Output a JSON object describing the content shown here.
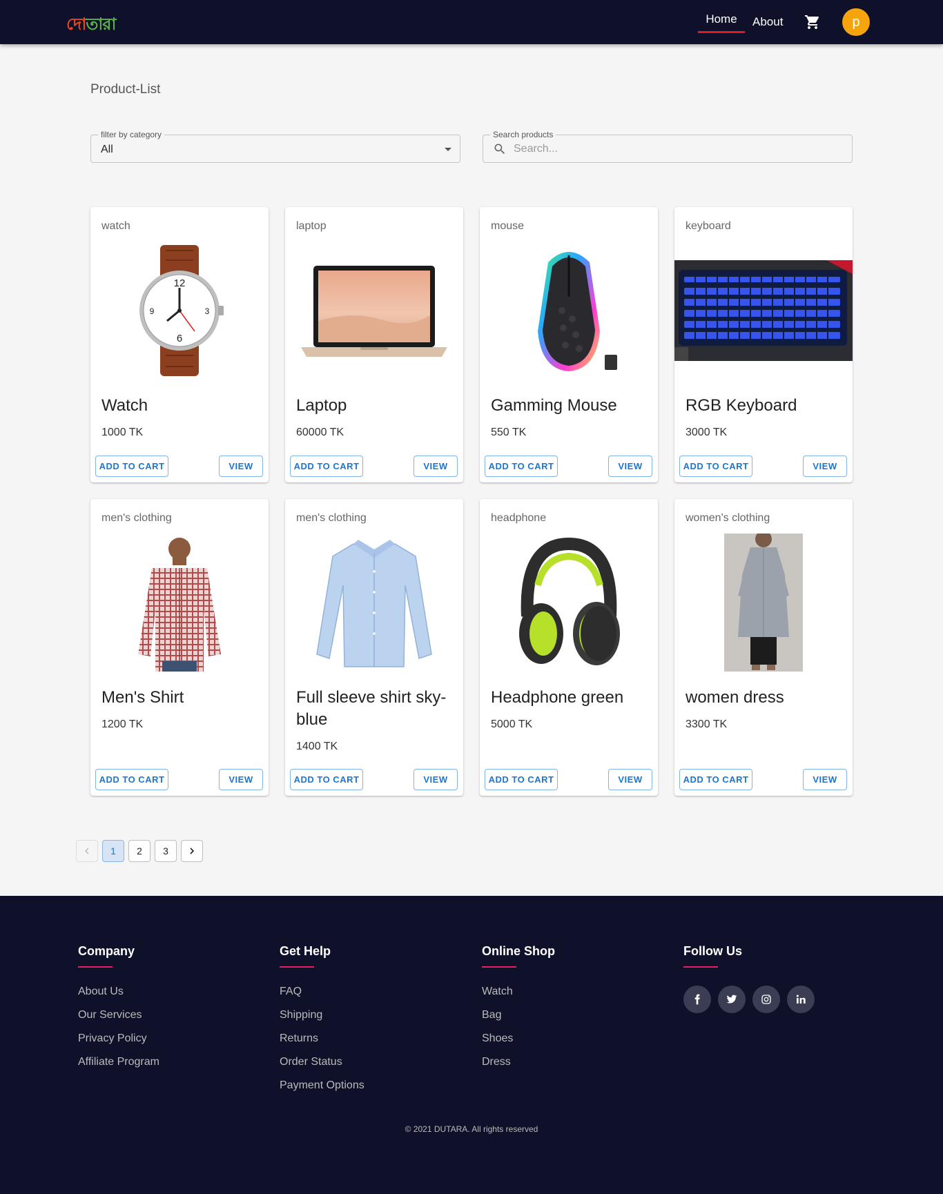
{
  "header": {
    "logo_part1": "দো",
    "logo_part2": "তারা",
    "nav_home": "Home",
    "nav_about": "About",
    "avatar_letter": "p",
    "accent_color": "#e01b24",
    "avatar_color": "#f5a40c"
  },
  "main": {
    "title": "Product-List",
    "category_filter": {
      "label": "filter by category",
      "value": "All"
    },
    "search": {
      "label": "Search products",
      "placeholder": "Search..."
    }
  },
  "products": [
    {
      "category": "watch",
      "title": "Watch",
      "price": "1000 TK",
      "add_label": "ADD TO CART",
      "view_label": "VIEW",
      "image": "watch-image"
    },
    {
      "category": "laptop",
      "title": "Laptop",
      "price": "60000 TK",
      "add_label": "ADD TO CART",
      "view_label": "VIEW",
      "image": "laptop-image"
    },
    {
      "category": "mouse",
      "title": "Gamming Mouse",
      "price": "550 TK",
      "add_label": "ADD TO CART",
      "view_label": "VIEW",
      "image": "mouse-image"
    },
    {
      "category": "keyboard",
      "title": "RGB Keyboard",
      "price": "3000 TK",
      "add_label": "ADD TO CART",
      "view_label": "VIEW",
      "image": "keyboard-image"
    },
    {
      "category": "men's clothing",
      "title": "Men's Shirt",
      "price": "1200 TK",
      "add_label": "ADD TO CART",
      "view_label": "VIEW",
      "image": "mens-shirt-image"
    },
    {
      "category": "men's clothing",
      "title": "Full sleeve shirt sky-blue",
      "price": "1400 TK",
      "add_label": "ADD TO CART",
      "view_label": "VIEW",
      "image": "blue-shirt-image"
    },
    {
      "category": "headphone",
      "title": "Headphone green",
      "price": "5000 TK",
      "add_label": "ADD TO CART",
      "view_label": "VIEW",
      "image": "headphone-image"
    },
    {
      "category": "women's clothing",
      "title": "women dress",
      "price": "3300 TK",
      "add_label": "ADD TO CART",
      "view_label": "VIEW",
      "image": "women-dress-image"
    }
  ],
  "pagination": {
    "pages": [
      "1",
      "2",
      "3"
    ],
    "current": "1"
  },
  "footer": {
    "company": {
      "heading": "Company",
      "links": [
        "About Us",
        "Our Services",
        "Privacy Policy",
        "Affiliate Program"
      ]
    },
    "help": {
      "heading": "Get Help",
      "links": [
        "FAQ",
        "Shipping",
        "Returns",
        "Order Status",
        "Payment Options"
      ]
    },
    "shop": {
      "heading": "Online Shop",
      "links": [
        "Watch",
        "Bag",
        "Shoes",
        "Dress"
      ]
    },
    "follow": {
      "heading": "Follow Us",
      "icons": [
        "facebook-icon",
        "twitter-icon",
        "instagram-icon",
        "linkedin-icon"
      ]
    },
    "copyright": "© 2021 DUTARA. All rights reserved",
    "accent_color": "#e91e63"
  }
}
